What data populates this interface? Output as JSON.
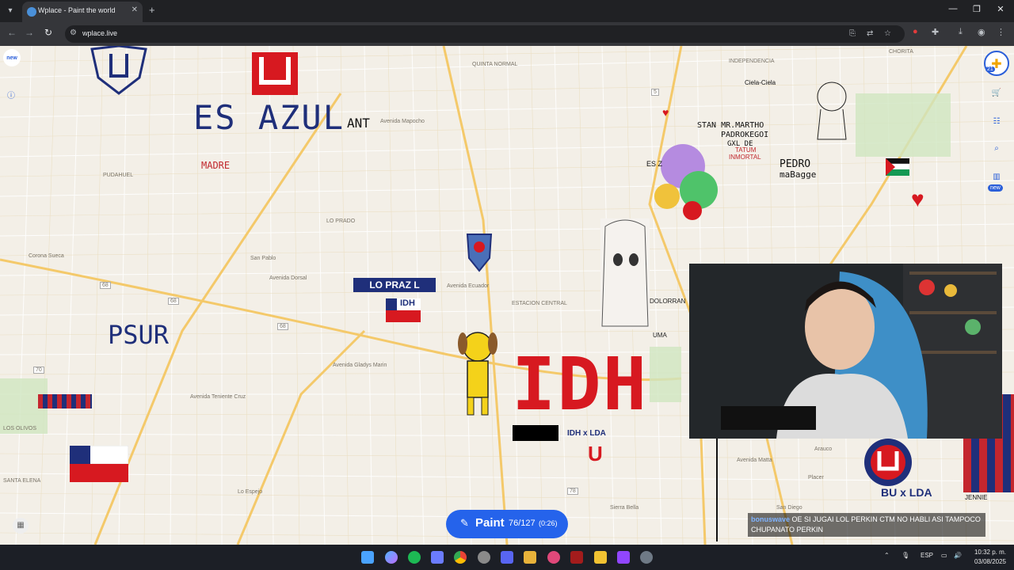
{
  "browser": {
    "tab_title": "Wplace - Paint the world",
    "url": "wplace.live",
    "tab_menu_icon": "chevron-down-icon",
    "new_tab": "+"
  },
  "map": {
    "street_labels": [
      "QUINTA NORMAL",
      "INDEPENDENCIA",
      "CHORITA",
      "Avenida Mapocho",
      "PUDAHUEL",
      "LO PRADO",
      "San Pablo",
      "Avenida Dorsal",
      "ESTACION CENTRAL",
      "Avenida Ecuador",
      "Corona Sueca",
      "SANTA ELENA",
      "LOS OLIVOS",
      "Arauco",
      "Placer",
      "Avenida Matta",
      "Sierra Bella",
      "Avenida Gladys Marin",
      "Avenida Teniente Cruz",
      "Lo Espejo",
      "San Diego"
    ],
    "route_shields": [
      "68",
      "68",
      "68",
      "70",
      "78",
      "5"
    ],
    "pixel_texts": [
      "ES AZUL",
      "ANT",
      "MADRE",
      "LO PRAZ L",
      "IDH",
      "PSUR",
      "IDH",
      "IDH x LDA",
      "U",
      "STAN MR.MARTHO",
      "PADROKEGOI",
      "GXL DE",
      "TATUM",
      "INMORTAL",
      "PEDRO",
      "maBagge",
      "Ciela-Ciela",
      "DOLORRAN",
      "UMA",
      "LDA",
      "JENNIE",
      "BU x LDA",
      "ES Z"
    ]
  },
  "sidebar_left": {
    "new_badge": "new"
  },
  "right_tools": {
    "level": "21",
    "new_badge": "new"
  },
  "paint_button": {
    "label": "Paint",
    "count": "76/127",
    "timer": "(0:26)"
  },
  "chat": {
    "username": "bonuswave",
    "message": "OE SI JUGAI LOL PERKIN CTM NO HABLI ASI TAMPOCO CHUPANATO PERKIN"
  },
  "taskbar": {
    "language": "ESP",
    "time": "10:32 p. m.",
    "date": "03/08/2025"
  },
  "colors": {
    "accent": "#2563eb",
    "idh_red": "#d71920",
    "u_blue": "#1f2f7a",
    "map_bg": "#f3efe7"
  }
}
